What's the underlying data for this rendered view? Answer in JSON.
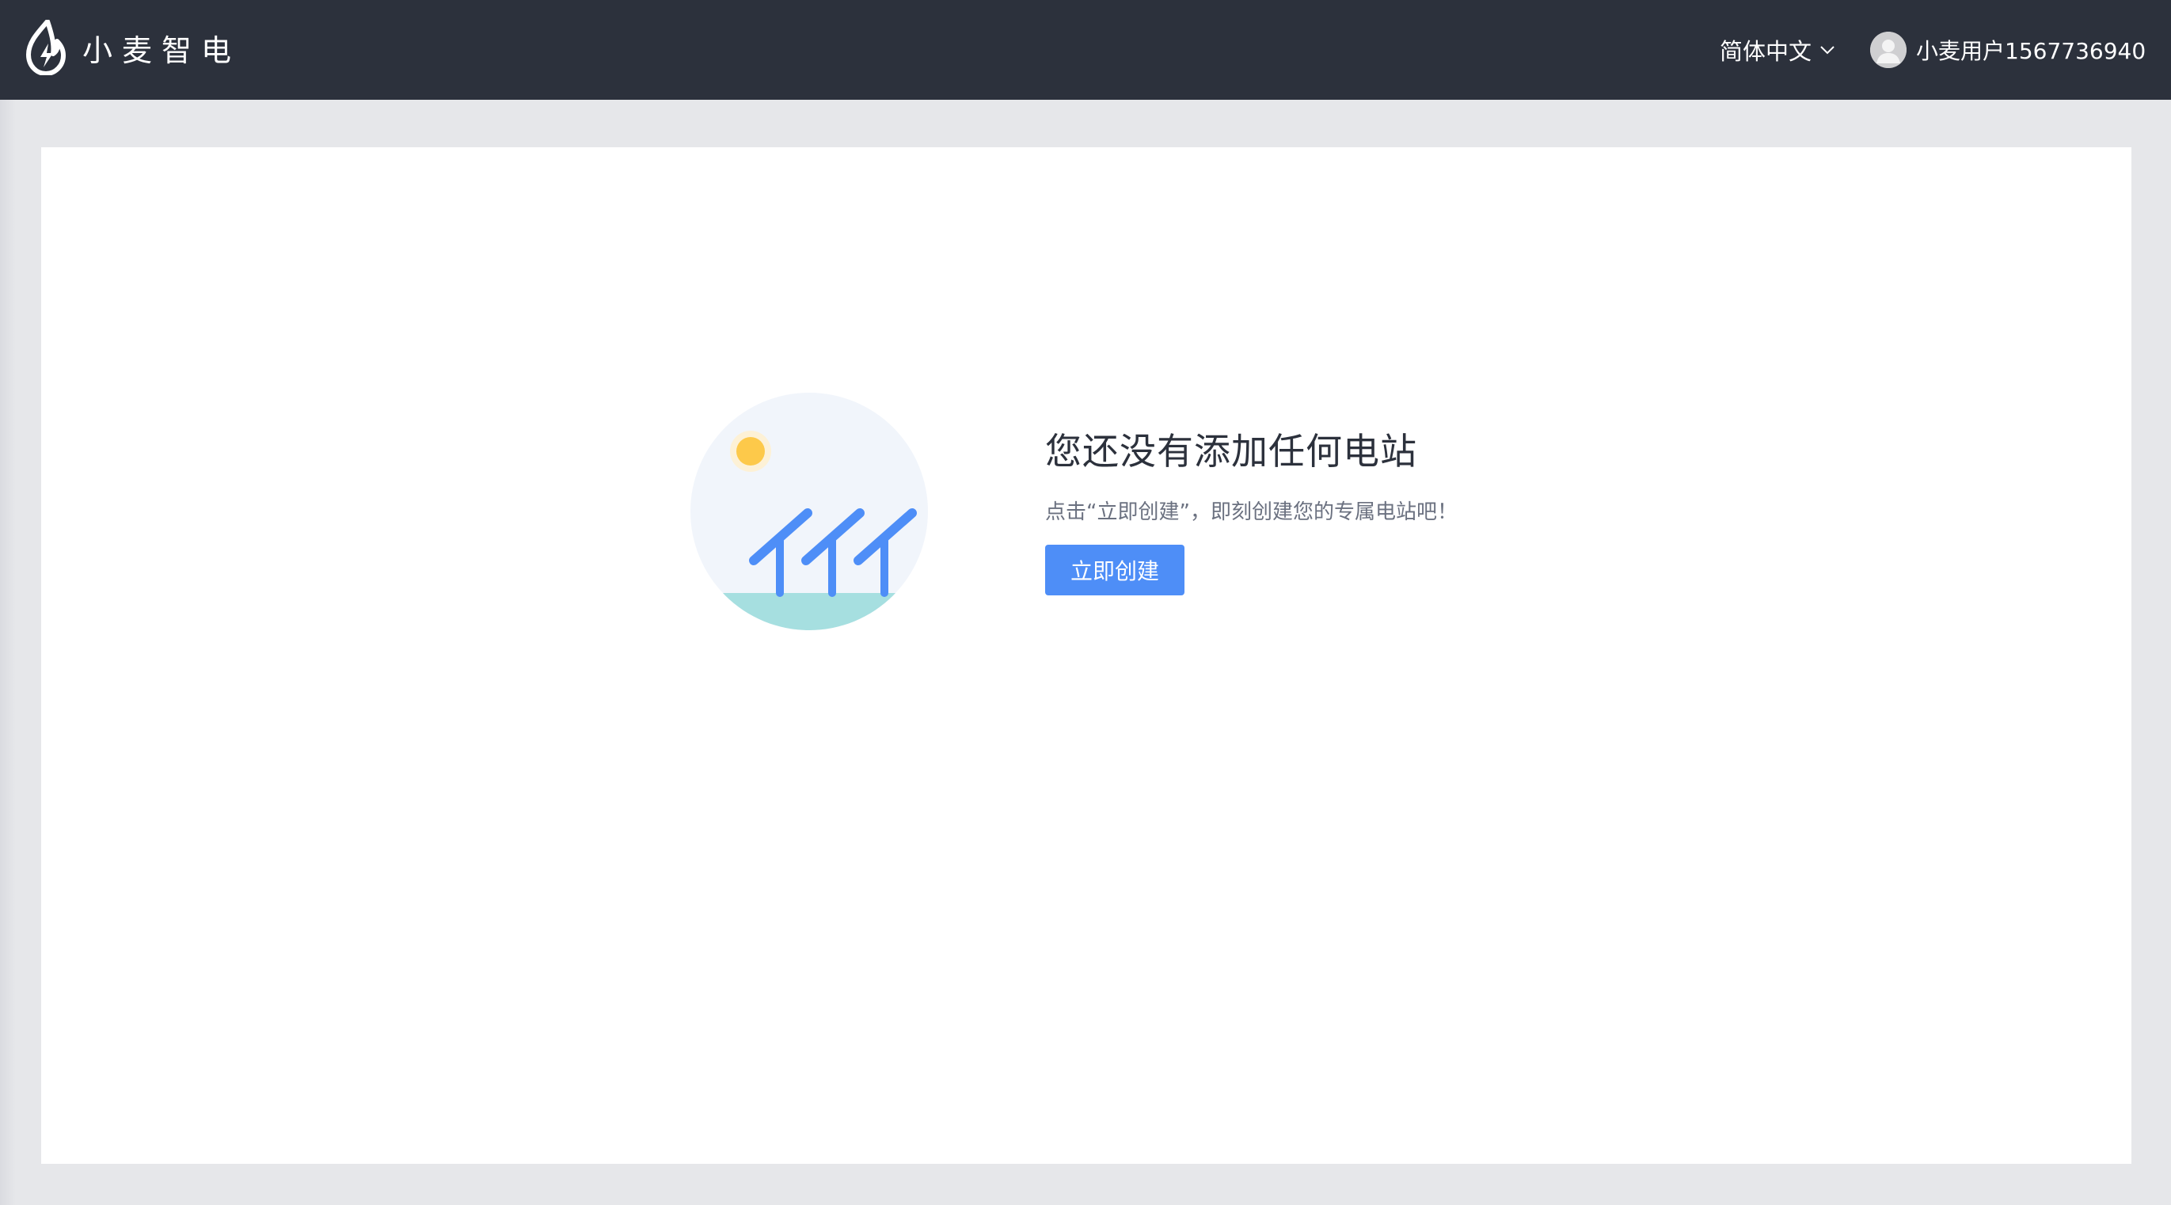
{
  "header": {
    "brand_name": "小麦智电",
    "logo_icon": "flame-lightning-icon",
    "language_label": "简体中文",
    "language_icon": "chevron-down-icon",
    "user_name": "小麦用户1567736940",
    "avatar_icon": "user-avatar-icon"
  },
  "empty_state": {
    "illustration_icon": "solar-panel-illustration",
    "title": "您还没有添加任何电站",
    "description": "点击“立即创建”，即刻创建您的专属电站吧！",
    "button_label": "立即创建"
  },
  "colors": {
    "topbar": "#2c313c",
    "background": "#e6e7ea",
    "panel": "#ffffff",
    "primary": "#4e8ef7",
    "sun": "#fdc94a",
    "ground": "#a6dfe0"
  }
}
